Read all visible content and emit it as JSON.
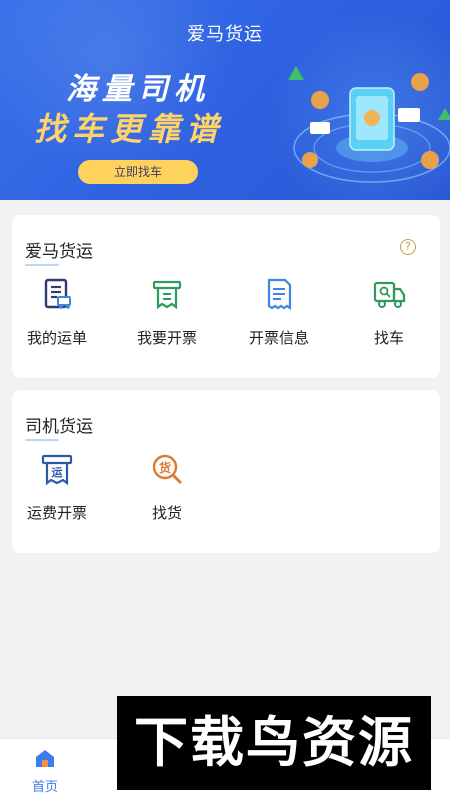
{
  "header": {
    "app_title": "爱马货运",
    "headline_line1": "海量司机",
    "headline_line2": "找车更靠谱",
    "cta_label": "立即找车"
  },
  "section_aima": {
    "title": "爱马货运",
    "help_icon": "question-circle-icon",
    "items": [
      {
        "label": "我的运单",
        "icon": "waybill-icon",
        "color": "#2f3e6e"
      },
      {
        "label": "我要开票",
        "icon": "invoice-icon",
        "color": "#2e9a5e"
      },
      {
        "label": "开票信息",
        "icon": "invoice-info-icon",
        "color": "#3f86e0"
      },
      {
        "label": "找车",
        "icon": "truck-icon",
        "color": "#2e9a5e"
      }
    ]
  },
  "section_driver": {
    "title": "司机货运",
    "items": [
      {
        "label": "运费开票",
        "icon": "freight-invoice-icon",
        "icon_char": "运",
        "color": "#2c5aa8"
      },
      {
        "label": "找货",
        "icon": "find-goods-icon",
        "icon_char": "货",
        "color": "#e07a2e"
      }
    ]
  },
  "tabbar": {
    "tabs": [
      {
        "label": "首页",
        "icon": "home-icon",
        "active": true
      }
    ]
  },
  "watermark": {
    "text": "下载鸟资源"
  }
}
